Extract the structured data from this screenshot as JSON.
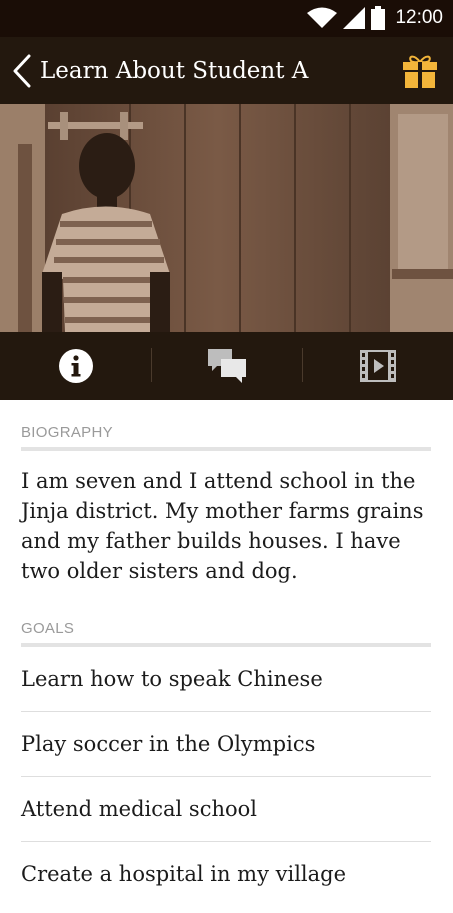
{
  "status_bar": {
    "time": "12:00"
  },
  "app_bar": {
    "title": "Learn About Student A",
    "icons": [
      "back-chevron-icon",
      "gift-icon"
    ]
  },
  "tabs": [
    {
      "icon": "info-icon",
      "active": true
    },
    {
      "icon": "chat-icon",
      "active": false
    },
    {
      "icon": "video-icon",
      "active": false
    }
  ],
  "biography": {
    "label": "BIOGRAPHY",
    "text": "I am seven and I attend school in the Jinja district. My mother farms grains and my father builds houses. I have two older sisters and dog."
  },
  "goals": {
    "label": "GOALS",
    "items": [
      "Learn how to speak Chinese",
      "Play soccer in the Olympics",
      "Attend medical school",
      "Create a hospital in my village"
    ]
  },
  "colors": {
    "bar": "#23180e",
    "accent": "#f3b53a",
    "status": "#1a0d06"
  }
}
